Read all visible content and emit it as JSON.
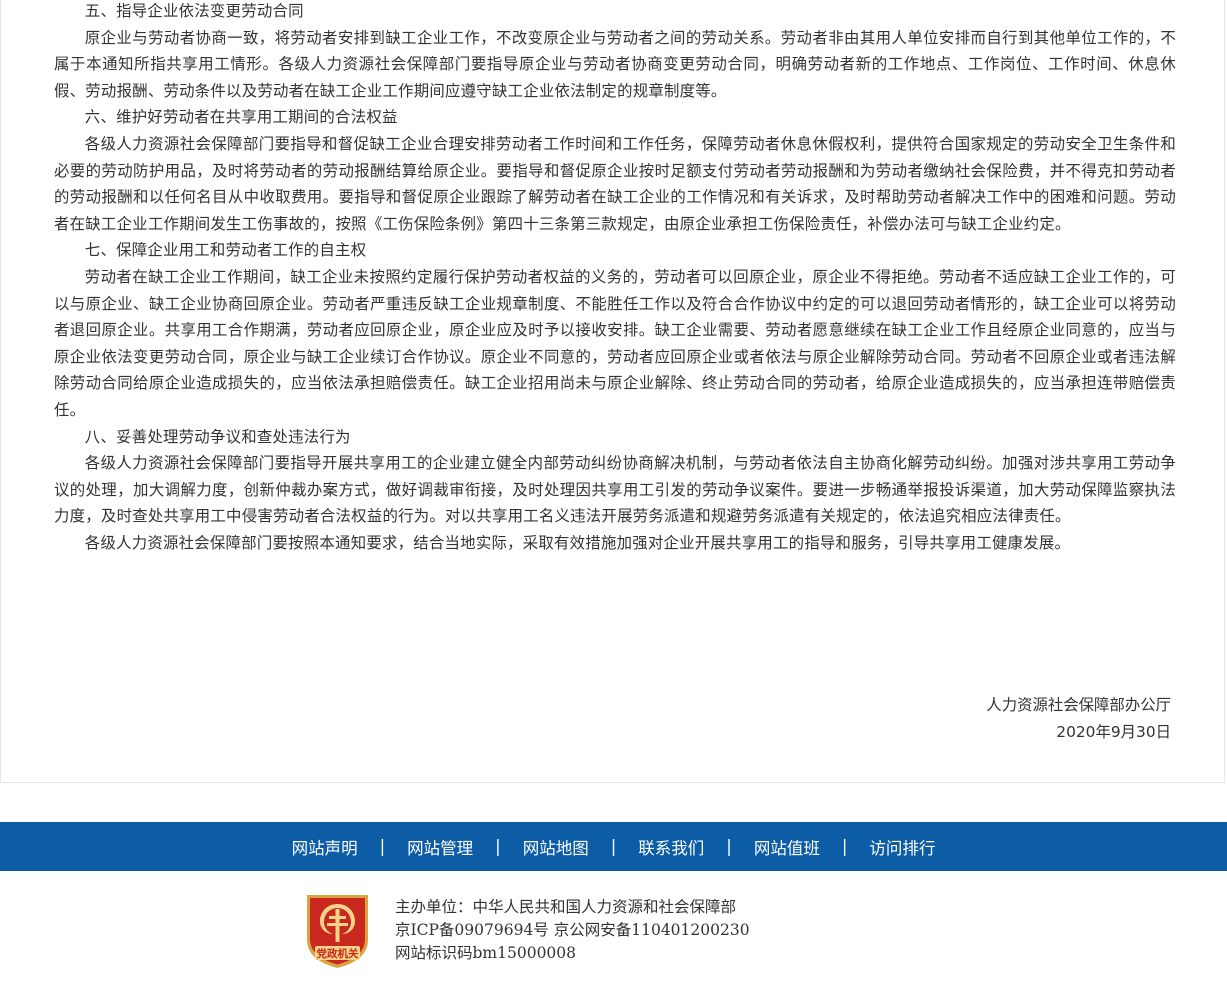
{
  "article": {
    "paragraphs": [
      "五、指导企业依法变更劳动合同",
      "原企业与劳动者协商一致，将劳动者安排到缺工企业工作，不改变原企业与劳动者之间的劳动关系。劳动者非由其用人单位安排而自行到其他单位工作的，不属于本通知所指共享用工情形。各级人力资源社会保障部门要指导原企业与劳动者协商变更劳动合同，明确劳动者新的工作地点、工作岗位、工作时间、休息休假、劳动报酬、劳动条件以及劳动者在缺工企业工作期间应遵守缺工企业依法制定的规章制度等。",
      "六、维护好劳动者在共享用工期间的合法权益",
      "各级人力资源社会保障部门要指导和督促缺工企业合理安排劳动者工作时间和工作任务，保障劳动者休息休假权利，提供符合国家规定的劳动安全卫生条件和必要的劳动防护用品，及时将劳动者的劳动报酬结算给原企业。要指导和督促原企业按时足额支付劳动者劳动报酬和为劳动者缴纳社会保险费，并不得克扣劳动者的劳动报酬和以任何名目从中收取费用。要指导和督促原企业跟踪了解劳动者在缺工企业的工作情况和有关诉求，及时帮助劳动者解决工作中的困难和问题。劳动者在缺工企业工作期间发生工伤事故的，按照《工伤保险条例》第四十三条第三款规定，由原企业承担工伤保险责任，补偿办法可与缺工企业约定。",
      "七、保障企业用工和劳动者工作的自主权",
      "劳动者在缺工企业工作期间，缺工企业未按照约定履行保护劳动者权益的义务的，劳动者可以回原企业，原企业不得拒绝。劳动者不适应缺工企业工作的，可以与原企业、缺工企业协商回原企业。劳动者严重违反缺工企业规章制度、不能胜任工作以及符合合作协议中约定的可以退回劳动者情形的，缺工企业可以将劳动者退回原企业。共享用工合作期满，劳动者应回原企业，原企业应及时予以接收安排。缺工企业需要、劳动者愿意继续在缺工企业工作且经原企业同意的，应当与原企业依法变更劳动合同，原企业与缺工企业续订合作协议。原企业不同意的，劳动者应回原企业或者依法与原企业解除劳动合同。劳动者不回原企业或者违法解除劳动合同给原企业造成损失的，应当依法承担赔偿责任。缺工企业招用尚未与原企业解除、终止劳动合同的劳动者，给原企业造成损失的，应当承担连带赔偿责任。",
      "八、妥善处理劳动争议和查处违法行为",
      "各级人力资源社会保障部门要指导开展共享用工的企业建立健全内部劳动纠纷协商解决机制，与劳动者依法自主协商化解劳动纠纷。加强对涉共享用工劳动争议的处理，加大调解力度，创新仲裁办案方式，做好调裁审衔接，及时处理因共享用工引发的劳动争议案件。要进一步畅通举报投诉渠道，加大劳动保障监察执法力度，及时查处共享用工中侵害劳动者合法权益的行为。对以共享用工名义违法开展劳务派遣和规避劳务派遣有关规定的，依法追究相应法律责任。",
      "各级人力资源社会保障部门要按照本通知要求，结合当地实际，采取有效措施加强对企业开展共享用工的指导和服务，引导共享用工健康发展。"
    ],
    "signature_org": "人力资源社会保障部办公厅",
    "signature_date": "2020年9月30日"
  },
  "footer_nav": {
    "links": [
      "网站声明",
      "网站管理",
      "网站地图",
      "联系我们",
      "网站值班",
      "访问排行"
    ],
    "separator": "|"
  },
  "footer_info": {
    "sponsor": "主办单位：中华人民共和国人力资源和社会保障部",
    "icp": "京ICP备09079694号 京公网安备110401200230",
    "site_id": "网站标识码bm15000008",
    "emblem_text": "党政机关"
  },
  "colors": {
    "nav_bg": "#0d5ca6",
    "emblem_red": "#c8281e",
    "emblem_gold": "#d9a441"
  }
}
